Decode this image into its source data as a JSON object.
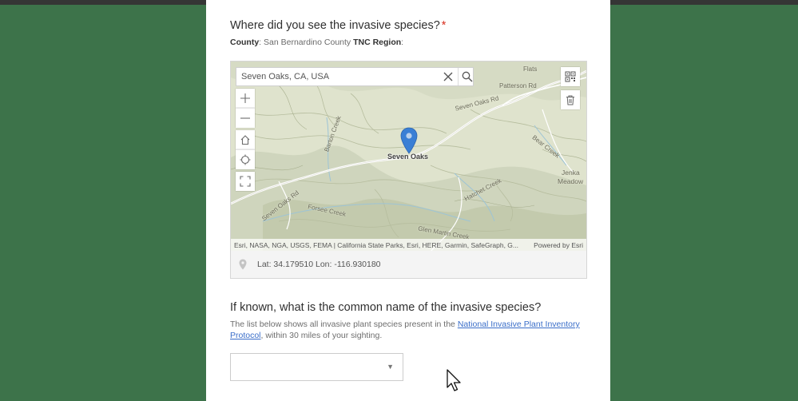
{
  "question1": {
    "title": "Where did you see the invasive species?",
    "required_marker": "*",
    "county_label": "County",
    "county_value": ": San Bernardino County",
    "region_label": "TNC Region",
    "region_value": ":"
  },
  "map": {
    "search_value": "Seven Oaks, CA, USA",
    "place_labels": [
      "Seven Oaks",
      "Jenka",
      "Meadow",
      "Flats"
    ],
    "road_labels": [
      "Seven Oaks Rd",
      "Patterson Rd",
      "Seven Oaks Rd",
      "Forsee Creek",
      "Bear Creek",
      "Hatchet Creek",
      "Barton Creek",
      "Glen Martin Creek"
    ],
    "attribution": "Esri, NASA, NGA, USGS, FEMA | California State Parks, Esri, HERE, Garmin, SafeGraph, G...",
    "powered_by": "Powered by Esri",
    "icons": {
      "search": "search-icon",
      "clear": "close-icon",
      "zoom_in": "plus-icon",
      "zoom_out": "minus-icon",
      "home": "home-icon",
      "locate": "locate-icon",
      "fullscreen": "fullscreen-icon",
      "qr": "qr-code-icon",
      "delete": "trash-icon",
      "pin": "map-pin-icon"
    }
  },
  "coordinates": {
    "text": "Lat: 34.179510  Lon: -116.930180"
  },
  "question2": {
    "title": "If known, what is the common name of the invasive species?",
    "desc_before": "The list below shows all invasive plant species present in the ",
    "link_text": "National Invasive Plant Inventory Protocol",
    "desc_after": ", within 30 miles of your sighting.",
    "dropdown_value": ""
  },
  "colors": {
    "background": "#3d734a",
    "panel": "#ffffff",
    "required": "#d83020",
    "link": "#3a6ec9",
    "pin": "#3a7fd5"
  }
}
